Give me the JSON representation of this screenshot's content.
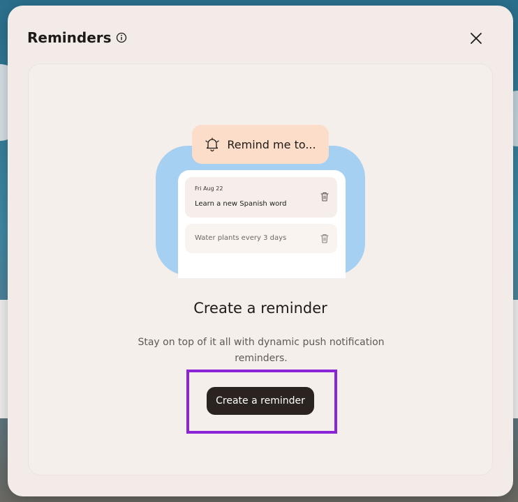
{
  "modal": {
    "title": "Reminders",
    "info_icon": "info-icon",
    "close_icon": "close-icon"
  },
  "illustration": {
    "prompt": "Remind me to...",
    "bell_icon": "bell-icon",
    "items": [
      {
        "date": "Fri Aug 22",
        "title": "Learn a new Spanish word",
        "icon": "trash-icon"
      },
      {
        "title": "Water plants every 3 days",
        "icon": "trash-icon"
      }
    ]
  },
  "empty_state": {
    "heading": "Create a reminder",
    "description": "Stay on top of it all with dynamic push notification reminders.",
    "button_label": "Create a reminder"
  },
  "colors": {
    "modal_bg": "#f2ebe7",
    "button_bg": "#2a231f",
    "highlight": "#8a24d6",
    "illustration_blue": "#a6d0f1",
    "illustration_peach": "#fbddca"
  }
}
